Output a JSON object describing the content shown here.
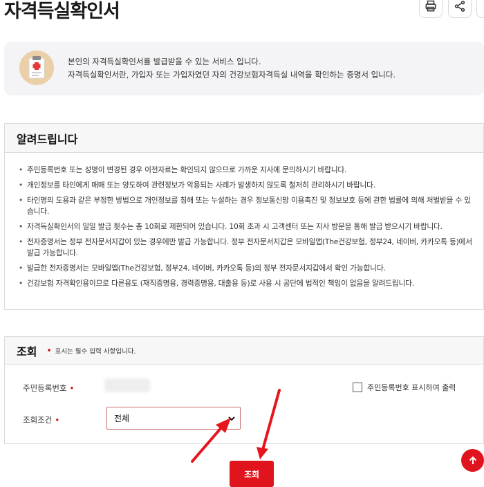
{
  "header": {
    "title": "자격득실확인서",
    "icons": [
      "printer-icon",
      "share-icon"
    ]
  },
  "intro": {
    "line1": "본인의 자격득실확인서를 발급받을 수 있는 서비스 입니다.",
    "line2": "자격득실확인서란, 가입자 또는 가입자였던 자의 건강보험자격득실 내역을 확인하는 증명서 입니다.",
    "icon": "document-clipboard-icon"
  },
  "notice": {
    "title": "알려드립니다",
    "items": [
      "주민등록번호 또는 성명이 변경된 경우 이전자료는 확인되지 않으므로 가까운 지사에 문의하시기 바랍니다.",
      "개인정보를 타인에게 매매 또는 양도하여 관련정보가 악용되는 사례가 발생하지 않도록 철저히 관리하시기 바랍니다.",
      "타인명의 도용과 같은 부정한 방법으로 개인정보를 침해 또는 누설하는 경우 정보통신망 이용촉진 및 정보보호 등에 관한 법률에 의해 처벌받을 수 있습니다.",
      "자격득실확인서의 일일 발급 횟수는 총 10회로 제한되어 있습니다. 10회 초과 시 고객센터 또는 지사 방문을 통해 발급 받으시기 바랍니다.",
      "전자증명서는 정부 전자문서지갑이 있는 경우에만 발급 가능합니다. 정부 전자문서지갑은 모바일앱(The건강보험, 정부24, 네이버, 카카오톡 등)에서 발급 가능합니다.",
      "발급한 전자증명서는 모바일앱(The건강보험, 정부24, 네이버, 카카오톡 등)의 정부 전자문서지갑에서 확인 가능합니다.",
      "건강보험 자격확인용이므로 다른용도 (재직증명용, 경력증명용, 대출용 등)로 사용 시 공단에 법적인 책임이 없음을 알려드립니다."
    ]
  },
  "query": {
    "title": "조회",
    "required_note": "표시는 필수 입력 사항입니다.",
    "required_mark": "•",
    "id_label": "주민등록번호",
    "condition_label": "조회조건",
    "show_id_checkbox_label": "주민등록번호 표시하여 출력",
    "condition_selected": "전체"
  },
  "submit_label": "조회",
  "colors": {
    "accent": "#e0141d",
    "required": "#d40000",
    "panel_bg": "#f4f4f6",
    "arrow": "#e8141c"
  }
}
